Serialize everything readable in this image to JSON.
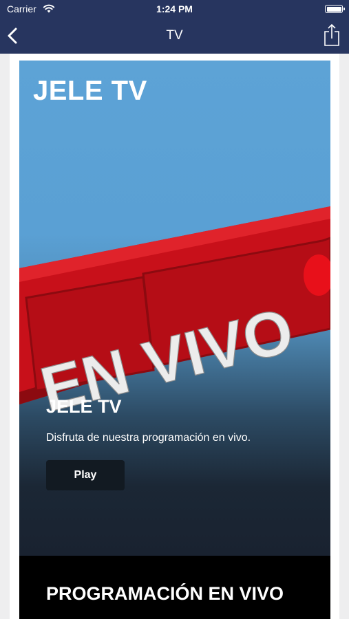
{
  "status_bar": {
    "carrier": "Carrier",
    "time": "1:24 PM"
  },
  "nav": {
    "title": "TV",
    "back_icon": "chevron-left-icon",
    "share_icon": "share-icon"
  },
  "hero": {
    "logo_text": "JELE TV",
    "banner_text": "EN VIVO",
    "title": "JELE TV",
    "description": "Disfruta de nuestra programación en vivo.",
    "play_label": "Play"
  },
  "section": {
    "title": "PROGRAMACIÓN EN VIVO"
  },
  "colors": {
    "nav_bar": "#27355f",
    "banner_red": "#c8101a",
    "sky_blue": "#5aa0d4"
  }
}
